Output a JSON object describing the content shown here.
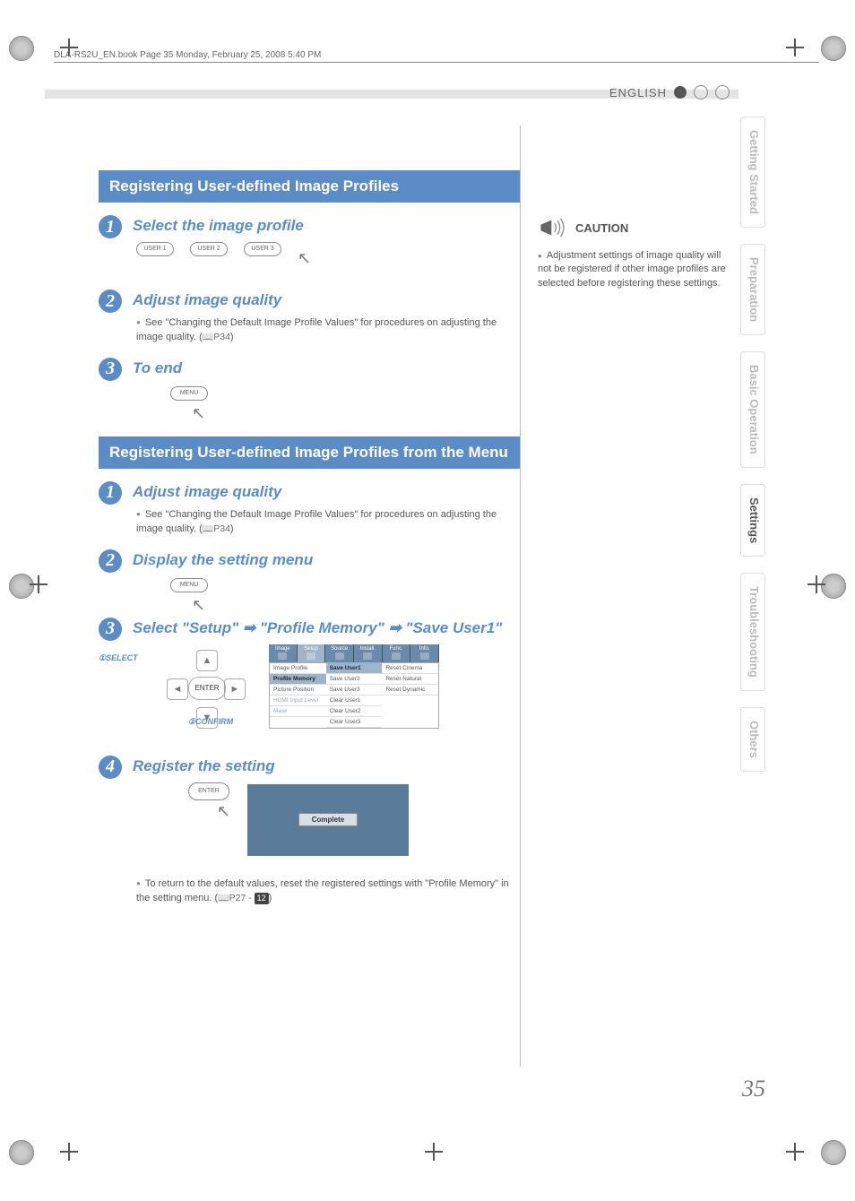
{
  "header": {
    "file_line": "DLA-RS2U_EN.book  Page 35  Monday, February 25, 2008  5:40 PM",
    "language": "ENGLISH"
  },
  "side_tabs": [
    "Getting Started",
    "Preparation",
    "Basic Operation",
    "Settings",
    "Troubleshooting",
    "Others"
  ],
  "section_a": {
    "banner": "Registering User-defined Image Profiles",
    "steps": {
      "s1": {
        "title": "Select the image profile"
      },
      "s2": {
        "title": "Adjust image quality",
        "body": "See \"Changing the Default Image Profile Values\" for procedures on adjusting the image quality. (",
        "ref": "P34",
        "body_end": ")"
      },
      "s3": {
        "title": "To end"
      }
    },
    "user_buttons": [
      "USER 1",
      "USER 2",
      "USER 3"
    ],
    "menu_label": "MENU"
  },
  "section_b": {
    "banner": "Registering User-defined Image Profiles from the Menu",
    "steps": {
      "s1": {
        "title": "Adjust image quality",
        "body": "See \"Changing the Default Image Profile Values\" for procedures on adjusting the image quality. (",
        "ref": "P34",
        "body_end": ")"
      },
      "s2": {
        "title": "Display the setting menu"
      },
      "s3": {
        "title": "Select \"Setup\" ➡ \"Profile Memory\" ➡ \"Save User1\""
      },
      "s4": {
        "title": "Register the setting",
        "note": "To return to the default values, reset the registered settings with \"Profile Memory\" in the setting menu. (",
        "ref": "P27 - ",
        "refnum": "12",
        "note_end": ")"
      }
    },
    "dpad": {
      "select_label": "SELECT",
      "confirm_label": "CONFIRM",
      "enter": "ENTER",
      "select_num": "①",
      "confirm_num": "②"
    },
    "menu_label": "MENU",
    "complete_label": "Complete",
    "menu_tabs": [
      "Image",
      "Setup",
      "Source",
      "Install.",
      "Func.",
      "Info."
    ],
    "menu_col1": [
      {
        "label": "Image Profile",
        "hl": false
      },
      {
        "label": "Profile Memory",
        "hl": true
      },
      {
        "label": "Picture Position",
        "hl": false
      },
      {
        "label": "HDMI Input Level",
        "hl": false
      },
      {
        "label": "Mask",
        "hl": false
      }
    ],
    "menu_col2": [
      {
        "label": "Save User1",
        "hl": true
      },
      {
        "label": "Save User2",
        "hl": false
      },
      {
        "label": "Save User3",
        "hl": false
      },
      {
        "label": "Clear User1",
        "hl": false
      },
      {
        "label": "Clear User2",
        "hl": false
      },
      {
        "label": "Clear User3",
        "hl": false
      }
    ],
    "menu_col3": [
      {
        "label": "Reset Cinema",
        "hl": false
      },
      {
        "label": "Reset Natural",
        "hl": false
      },
      {
        "label": "Reset Dynamic",
        "hl": false
      }
    ]
  },
  "caution": {
    "label": "CAUTION",
    "text": "Adjustment settings of image quality will not be registered if other image profiles are selected before registering these settings."
  },
  "page_number": "35"
}
